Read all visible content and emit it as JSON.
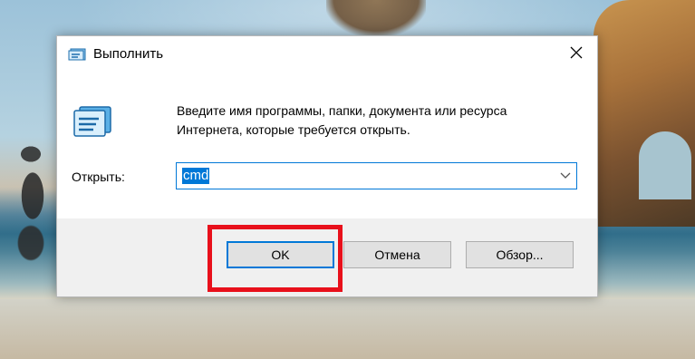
{
  "dialog": {
    "title": "Выполнить",
    "description": "Введите имя программы, папки, документа или ресурса Интернета, которые требуется открыть.",
    "open_label": "Открыть:",
    "open_value": "cmd",
    "buttons": {
      "ok": "OK",
      "cancel": "Отмена",
      "browse": "Обзор..."
    },
    "icons": {
      "title": "run-icon",
      "close": "close-icon",
      "dropdown": "chevron-down-icon"
    }
  },
  "annotation": {
    "highlight_color": "#e8101b"
  },
  "colors": {
    "accent": "#0078d7",
    "button_bg": "#e1e1e1"
  }
}
